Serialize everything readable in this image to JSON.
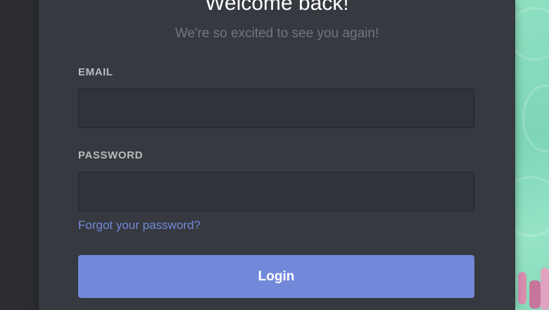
{
  "login": {
    "title": "Welcome back!",
    "subtitle": "We're so excited to see you again!",
    "email_label": "EMAIL",
    "email_value": "",
    "password_label": "PASSWORD",
    "password_value": "",
    "forgot_link": "Forgot your password?",
    "login_button": "Login"
  },
  "colors": {
    "card_background": "#36393f",
    "input_background": "#303339",
    "accent": "#7289da",
    "side_background": "#2b2d31",
    "decor_background": "#8fe0c2"
  }
}
